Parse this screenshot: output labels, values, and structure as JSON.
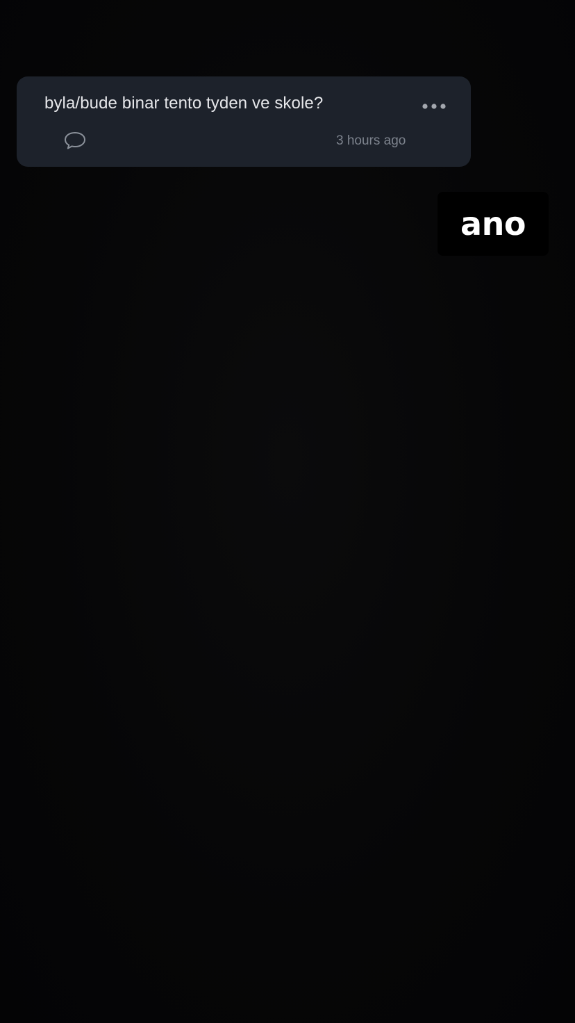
{
  "card": {
    "question": "byla/bude binar tento tyden ve skole?",
    "time": "3 hours ago",
    "more_icon": "more-horizontal-icon",
    "comment_icon": "comment-bubble-icon"
  },
  "sticker": {
    "text": "ano"
  },
  "colors": {
    "background": "#050506",
    "card": "#1d222b",
    "question_text": "#e6e7ea",
    "secondary_text": "#7d838d",
    "sticker_text": "#ffffff"
  }
}
